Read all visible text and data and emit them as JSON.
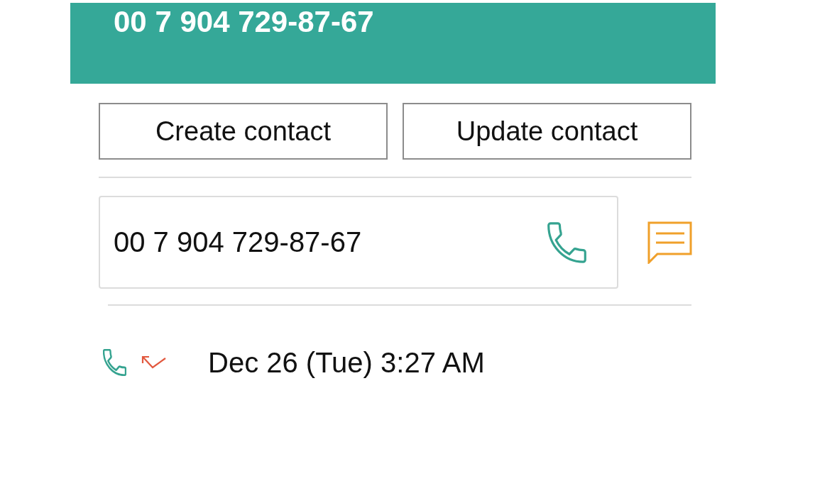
{
  "header": {
    "title": "00 7 904 729-87-67"
  },
  "actions": [
    {
      "label": "Create contact"
    },
    {
      "label": "Update contact"
    }
  ],
  "number_card": {
    "number": "00 7 904 729-87-67"
  },
  "call_log": [
    {
      "kind": "missed",
      "time": "Dec 26 (Tue) 3:27 AM"
    }
  ]
}
